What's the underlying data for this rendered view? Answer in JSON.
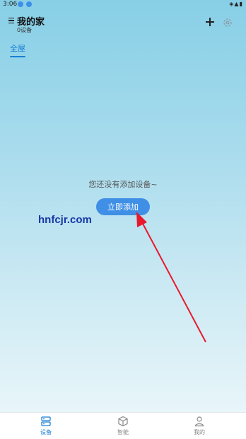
{
  "status_bar": {
    "time": "3:06"
  },
  "header": {
    "title": "我的家",
    "device_count": "0设备"
  },
  "tabs": [
    {
      "label": "全屋",
      "active": true
    }
  ],
  "empty_state": {
    "message": "您还没有添加设备~",
    "add_button_label": "立即添加"
  },
  "watermark": "hnfcjr.com",
  "bottom_nav": [
    {
      "label": "设备",
      "icon": "device-icon",
      "active": true
    },
    {
      "label": "智能",
      "icon": "cube-icon",
      "active": false
    },
    {
      "label": "我的",
      "icon": "person-icon",
      "active": false
    }
  ],
  "colors": {
    "accent": "#1a7fd4",
    "button": "#3f8fe6",
    "watermark": "#1737a6",
    "arrow": "#e8192c"
  }
}
